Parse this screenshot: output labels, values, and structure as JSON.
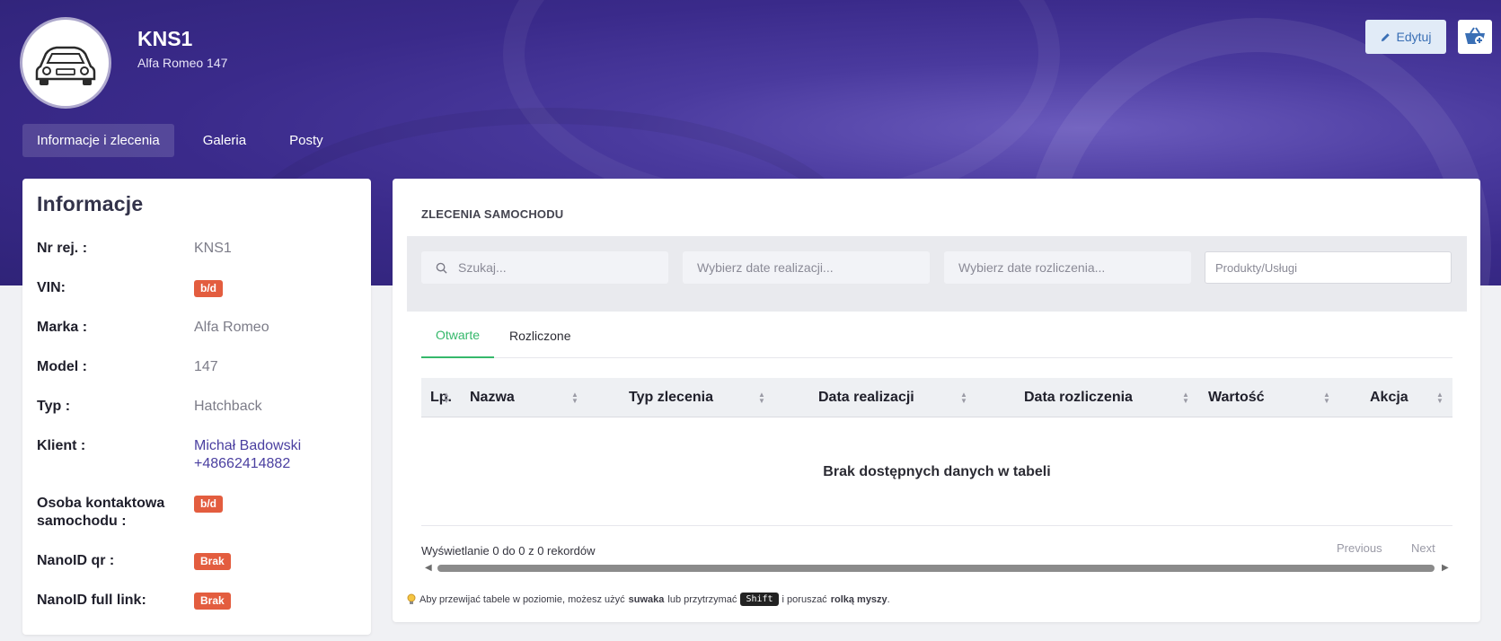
{
  "header": {
    "title": "KNS1",
    "subtitle": "Alfa Romeo 147",
    "edit_label": "Edytuj",
    "tabs": [
      {
        "label": "Informacje i zlecenia"
      },
      {
        "label": "Galeria"
      },
      {
        "label": "Posty"
      }
    ]
  },
  "info": {
    "title": "Informacje",
    "rows": [
      {
        "label": "Nr rej. :",
        "value": "KNS1"
      },
      {
        "label": "VIN:",
        "badge": "b/d"
      },
      {
        "label": "Marka :",
        "value": "Alfa Romeo"
      },
      {
        "label": "Model :",
        "value": "147"
      },
      {
        "label": "Typ :",
        "value": "Hatchback"
      },
      {
        "label": "Klient :",
        "value": "Michał Badowski",
        "value2": "+48662414882"
      },
      {
        "label": "Osoba kontaktowa samochodu :",
        "badge": "b/d"
      },
      {
        "label": "NanoID qr :",
        "badge": "Brak"
      },
      {
        "label": "NanoID full link:",
        "badge": "Brak"
      }
    ]
  },
  "orders": {
    "title": "ZLECENIA SAMOCHODU",
    "filters": {
      "search_placeholder": "Szukaj...",
      "realization_placeholder": "Wybierz date realizacji...",
      "settlement_placeholder": "Wybierz date rozliczenia...",
      "products_placeholder": "Produkty/Usługi"
    },
    "tabs": [
      {
        "label": "Otwarte"
      },
      {
        "label": "Rozliczone"
      }
    ],
    "columns": [
      "Lp.",
      "Nazwa",
      "Typ zlecenia",
      "Data realizacji",
      "Data rozliczenia",
      "Wartość",
      "Akcja"
    ],
    "empty_text": "Brak dostępnych danych w tabeli",
    "records_text": "Wyświetlanie 0 do 0 z 0 rekordów",
    "previous_label": "Previous",
    "next_label": "Next",
    "hint": {
      "part1": "Aby przewijać tabele w poziomie, możesz użyć",
      "bold1": "suwaka",
      "part2": "lub przytrzymać",
      "key": "Shift",
      "part3": "i poruszać",
      "bold2": "rolką myszy",
      "end": "."
    }
  },
  "colors": {
    "accent": "#35b86b",
    "badge": "#e35d3f",
    "hero": "#3a2a8a",
    "link": "#4a3fa0"
  }
}
